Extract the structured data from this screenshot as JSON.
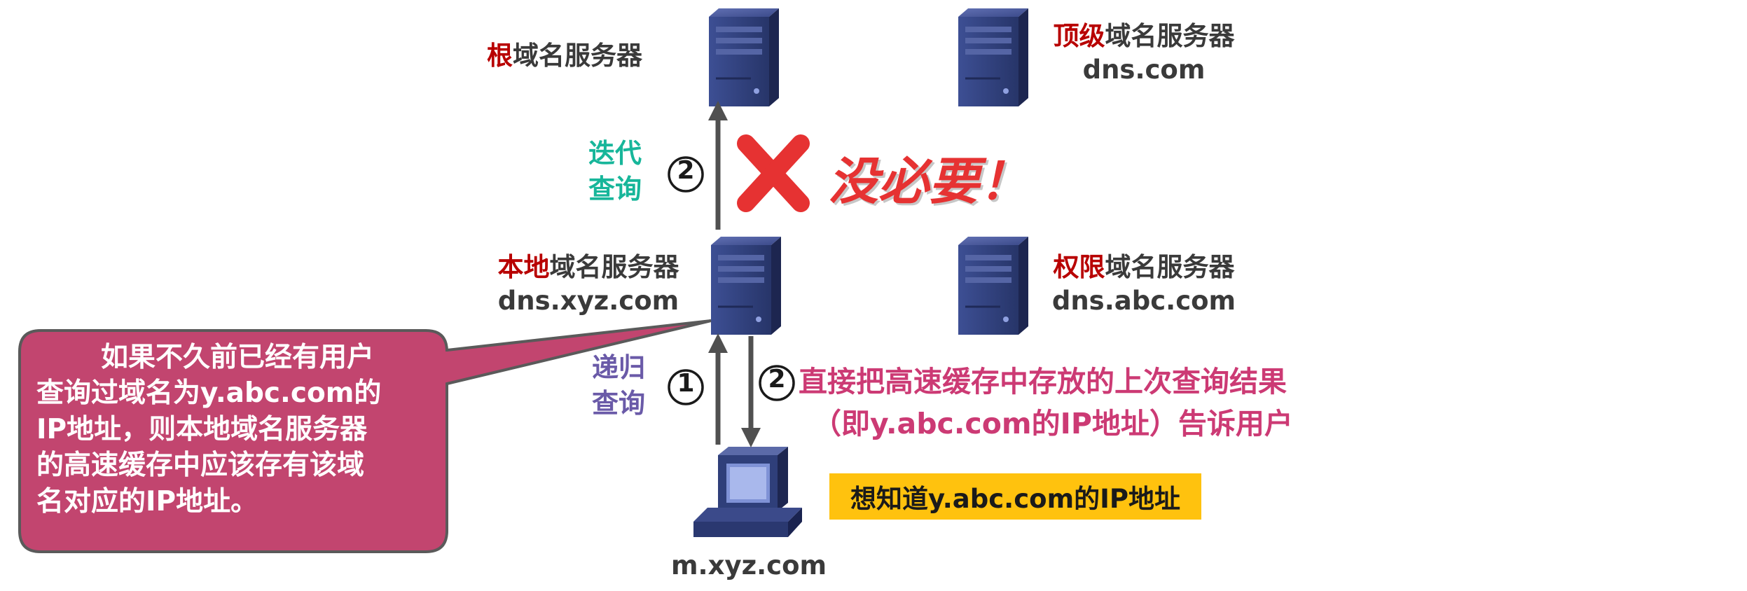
{
  "servers": {
    "root": {
      "highlight": "根",
      "rest": "域名服务器",
      "domain": ""
    },
    "tld": {
      "highlight": "顶级",
      "rest": "域名服务器",
      "domain": "dns.com"
    },
    "local": {
      "highlight": "本地",
      "rest": "域名服务器",
      "domain": "dns.xyz.com"
    },
    "authoritative": {
      "highlight": "权限",
      "rest": "域名服务器",
      "domain": "dns.abc.com"
    }
  },
  "host": {
    "domain": "m.xyz.com"
  },
  "iterative_query": {
    "line1": "迭代",
    "line2": "查询",
    "step": "2"
  },
  "recursive_query": {
    "line1": "递归",
    "line2": "查询",
    "step": "1"
  },
  "reply": {
    "step": "2",
    "line1": "直接把高速缓存中存放的上次查询结果",
    "line2": "（即y.abc.com的IP地址）告诉用户"
  },
  "not_needed": "没必要！",
  "want_box": "想知道y.abc.com的IP地址",
  "callout": {
    "lines": [
      "如果不久前已经有用户",
      "查询过域名为y.abc.com的",
      "IP地址，则本地域名服务器",
      "的高速缓存中应该存有该域",
      "名对应的IP地址。"
    ]
  },
  "colors": {
    "server_front": "#2f3f7a",
    "server_side": "#1d2650",
    "callout_fill": "#c2456f",
    "callout_border": "#5a5a5a",
    "cross": "#e63232",
    "highlight_box": "#ffc20e"
  }
}
